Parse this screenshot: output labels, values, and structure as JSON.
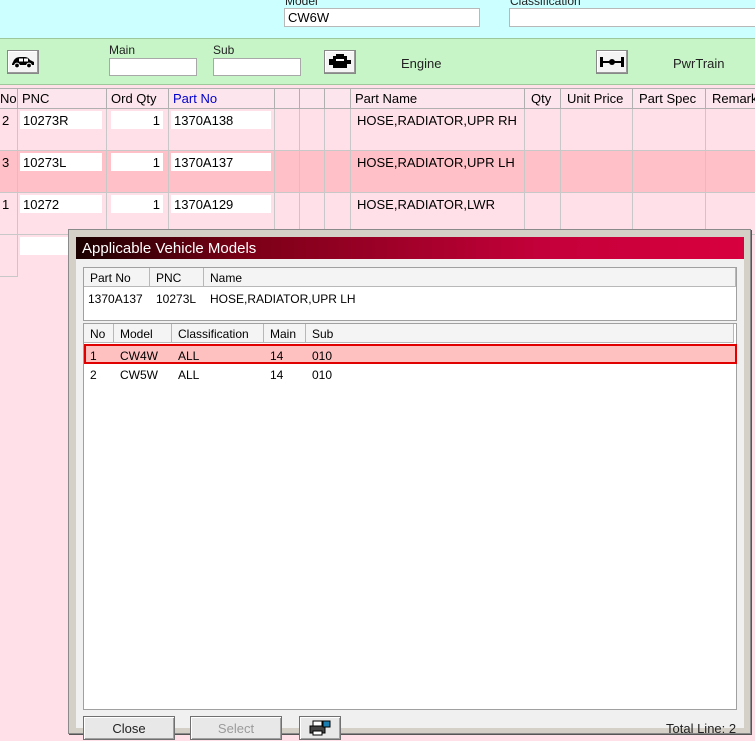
{
  "header": {
    "model_label": "Model",
    "model_value": "CW6W",
    "classification_label": "Classification",
    "classification_value": ""
  },
  "toolbar": {
    "main_label": "Main",
    "main_value": "",
    "sub_label": "Sub",
    "sub_value": "",
    "engine_label": "Engine",
    "pwrtrain_label": "PwrTrain"
  },
  "grid": {
    "columns": {
      "no": "No",
      "pnc": "PNC",
      "ord_qty": "Ord Qty",
      "part_no": "Part No",
      "part_name": "Part Name",
      "qty": "Qty",
      "unit_price": "Unit Price",
      "part_spec": "Part Spec",
      "remarks": "Remarks"
    },
    "part_no_color": "#0000cc",
    "selected_row_color": "#ffc0c8",
    "rows": [
      {
        "no": "2",
        "pnc": "10273R",
        "ord_qty": "1",
        "part_no": "1370A138",
        "part_name": "HOSE,RADIATOR,UPR RH"
      },
      {
        "no": "3",
        "pnc": "10273L",
        "ord_qty": "1",
        "part_no": "1370A137",
        "part_name": "HOSE,RADIATOR,UPR LH"
      },
      {
        "no": "1",
        "pnc": "10272",
        "ord_qty": "1",
        "part_no": "1370A129",
        "part_name": "HOSE,RADIATOR,LWR"
      }
    ]
  },
  "dialog": {
    "title": "Applicable Vehicle Models",
    "info": {
      "headers": {
        "part_no": "Part No",
        "pnc": "PNC",
        "name": "Name"
      },
      "part_no": "1370A137",
      "pnc": "10273L",
      "name": "HOSE,RADIATOR,UPR LH"
    },
    "list": {
      "headers": {
        "no": "No",
        "model": "Model",
        "classification": "Classification",
        "main": "Main",
        "sub": "Sub"
      },
      "rows": [
        {
          "no": "1",
          "model": "CW4W",
          "classification": "ALL",
          "main": "14",
          "sub": "010"
        },
        {
          "no": "2",
          "model": "CW5W",
          "classification": "ALL",
          "main": "14",
          "sub": "010"
        }
      ]
    },
    "close_label": "Close",
    "select_label": "Select",
    "total_line": "Total Line: 2"
  }
}
